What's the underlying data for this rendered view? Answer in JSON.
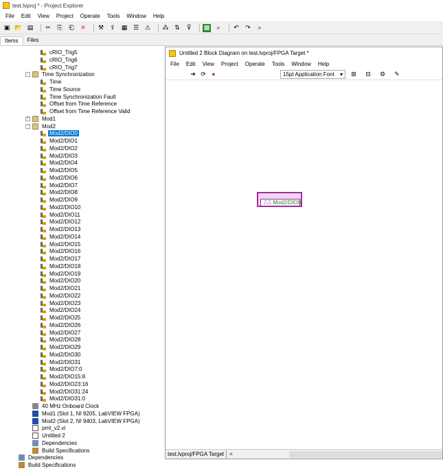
{
  "window": {
    "title": "test.lvproj * - Project Explorer"
  },
  "menu": [
    "File",
    "Edit",
    "View",
    "Project",
    "Operate",
    "Tools",
    "Window",
    "Help"
  ],
  "toolbar_icons": [
    "new-icon",
    "open-icon",
    "save-all-icon",
    "cut-icon",
    "copy-icon",
    "paste-icon",
    "delete-icon",
    "build-icon",
    "deploy-icon",
    "view-icon",
    "properties-icon",
    "warning-icon",
    "group-icon",
    "sort-icon",
    "filter-icon",
    "fpga-icon",
    "find-icon",
    "undo-icon",
    "redo-icon",
    "search-icon"
  ],
  "tabs": [
    {
      "label": "Items",
      "active": true
    },
    {
      "label": "Files",
      "active": false
    }
  ],
  "tree": [
    {
      "label": "cRIO_Trig5",
      "icon": "io",
      "indent": 3
    },
    {
      "label": "cRIO_Trig6",
      "icon": "io",
      "indent": 3
    },
    {
      "label": "cRIO_Trig7",
      "icon": "io",
      "indent": 3
    },
    {
      "label": "Time Synchronization",
      "icon": "folder",
      "indent": 2,
      "expander": "-"
    },
    {
      "label": "Time",
      "icon": "io",
      "indent": 3
    },
    {
      "label": "Time Source",
      "icon": "io",
      "indent": 3
    },
    {
      "label": "Time Synchronization Fault",
      "icon": "io",
      "indent": 3
    },
    {
      "label": "Offset from Time Reference",
      "icon": "io",
      "indent": 3
    },
    {
      "label": "Offset from Time Reference Valid",
      "icon": "io",
      "indent": 3
    },
    {
      "label": "Mod1",
      "icon": "folder",
      "indent": 2,
      "expander": "+"
    },
    {
      "label": "Mod2",
      "icon": "folder",
      "indent": 2,
      "expander": "-"
    },
    {
      "label": "Mod2/DIO0",
      "icon": "io",
      "indent": 3,
      "selected": true
    },
    {
      "label": "Mod2/DIO1",
      "icon": "io",
      "indent": 3
    },
    {
      "label": "Mod2/DIO2",
      "icon": "io",
      "indent": 3
    },
    {
      "label": "Mod2/DIO3",
      "icon": "io",
      "indent": 3
    },
    {
      "label": "Mod2/DIO4",
      "icon": "io",
      "indent": 3
    },
    {
      "label": "Mod2/DIO5",
      "icon": "io",
      "indent": 3
    },
    {
      "label": "Mod2/DIO6",
      "icon": "io",
      "indent": 3
    },
    {
      "label": "Mod2/DIO7",
      "icon": "io",
      "indent": 3
    },
    {
      "label": "Mod2/DIO8",
      "icon": "io",
      "indent": 3
    },
    {
      "label": "Mod2/DIO9",
      "icon": "io",
      "indent": 3
    },
    {
      "label": "Mod2/DIO10",
      "icon": "io",
      "indent": 3
    },
    {
      "label": "Mod2/DIO11",
      "icon": "io",
      "indent": 3
    },
    {
      "label": "Mod2/DIO12",
      "icon": "io",
      "indent": 3
    },
    {
      "label": "Mod2/DIO13",
      "icon": "io",
      "indent": 3
    },
    {
      "label": "Mod2/DIO14",
      "icon": "io",
      "indent": 3
    },
    {
      "label": "Mod2/DIO15",
      "icon": "io",
      "indent": 3
    },
    {
      "label": "Mod2/DIO16",
      "icon": "io",
      "indent": 3
    },
    {
      "label": "Mod2/DIO17",
      "icon": "io",
      "indent": 3
    },
    {
      "label": "Mod2/DIO18",
      "icon": "io",
      "indent": 3
    },
    {
      "label": "Mod2/DIO19",
      "icon": "io",
      "indent": 3
    },
    {
      "label": "Mod2/DIO20",
      "icon": "io",
      "indent": 3
    },
    {
      "label": "Mod2/DIO21",
      "icon": "io",
      "indent": 3
    },
    {
      "label": "Mod2/DIO22",
      "icon": "io",
      "indent": 3
    },
    {
      "label": "Mod2/DIO23",
      "icon": "io",
      "indent": 3
    },
    {
      "label": "Mod2/DIO24",
      "icon": "io",
      "indent": 3
    },
    {
      "label": "Mod2/DIO25",
      "icon": "io",
      "indent": 3
    },
    {
      "label": "Mod2/DIO26",
      "icon": "io",
      "indent": 3
    },
    {
      "label": "Mod2/DIO27",
      "icon": "io",
      "indent": 3
    },
    {
      "label": "Mod2/DIO28",
      "icon": "io",
      "indent": 3
    },
    {
      "label": "Mod2/DIO29",
      "icon": "io",
      "indent": 3
    },
    {
      "label": "Mod2/DIO30",
      "icon": "io",
      "indent": 3
    },
    {
      "label": "Mod2/DIO31",
      "icon": "io",
      "indent": 3
    },
    {
      "label": "Mod2/DIO7:0",
      "icon": "io",
      "indent": 3
    },
    {
      "label": "Mod2/DIO15:8",
      "icon": "io",
      "indent": 3
    },
    {
      "label": "Mod2/DIO23:16",
      "icon": "io",
      "indent": 3
    },
    {
      "label": "Mod2/DIO31:24",
      "icon": "io",
      "indent": 3
    },
    {
      "label": "Mod2/DIO31:0",
      "icon": "io",
      "indent": 3
    },
    {
      "label": "40 MHz Onboard Clock",
      "icon": "clock",
      "indent": 2
    },
    {
      "label": "Mod1 (Slot 1, NI 9205, LabVIEW FPGA)",
      "icon": "module",
      "indent": 2
    },
    {
      "label": "Mod2 (Slot 2, NI 9403, LabVIEW FPGA)",
      "icon": "module",
      "indent": 2
    },
    {
      "label": "pmt_v2.vi",
      "icon": "vi",
      "indent": 2
    },
    {
      "label": "Untitled 2",
      "icon": "vi",
      "indent": 2
    },
    {
      "label": "Dependencies",
      "icon": "dep",
      "indent": 2
    },
    {
      "label": "Build Specifications",
      "icon": "build",
      "indent": 2
    },
    {
      "label": "Dependencies",
      "icon": "dep",
      "indent": 1
    },
    {
      "label": "Build Specifications",
      "icon": "build",
      "indent": 1
    }
  ],
  "block_diagram": {
    "title": "Untitled 2 Block Diagram on test.lvproj/FPGA Target *",
    "menu": [
      "File",
      "Edit",
      "View",
      "Project",
      "Operate",
      "Tools",
      "Window",
      "Help"
    ],
    "font_select": "15pt Application Font",
    "node_label": "Mod2/DIO0",
    "node_glyph": "⎍⎍",
    "status_path": "test.lvproj/FPGA Target",
    "scroll_left": "<"
  },
  "colors": {
    "selection": "#0078d7",
    "node_border": "#9b2c9b",
    "node_fill": "#f3d6f3",
    "node_text": "#2d7a2d"
  }
}
